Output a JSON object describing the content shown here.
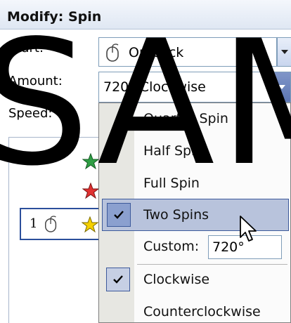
{
  "pane": {
    "title": "Modify: Spin"
  },
  "start": {
    "label": "Start:",
    "value": "On Click",
    "icon": "mouse-icon"
  },
  "amount": {
    "label": "Amount:",
    "value": "720° Clockwise"
  },
  "speed": {
    "label": "Speed:"
  },
  "list": {
    "selected_number": "1"
  },
  "menu": {
    "items": [
      {
        "label": "Quarter Spin",
        "checked": false,
        "highlighted": false
      },
      {
        "label": "Half Spin",
        "checked": false,
        "highlighted": false
      },
      {
        "label": "Full Spin",
        "checked": false,
        "highlighted": false
      },
      {
        "label": "Two Spins",
        "checked": true,
        "highlighted": true
      }
    ],
    "custom": {
      "label": "Custom:",
      "value": "720°"
    },
    "direction": [
      {
        "label": "Clockwise",
        "checked": true
      },
      {
        "label": "Counterclockwise",
        "checked": false
      }
    ]
  },
  "watermark": "SAM",
  "colors": {
    "accent": "#3d5a9b",
    "highlight": "#b8c3dc",
    "header": "#dfe7f3"
  }
}
